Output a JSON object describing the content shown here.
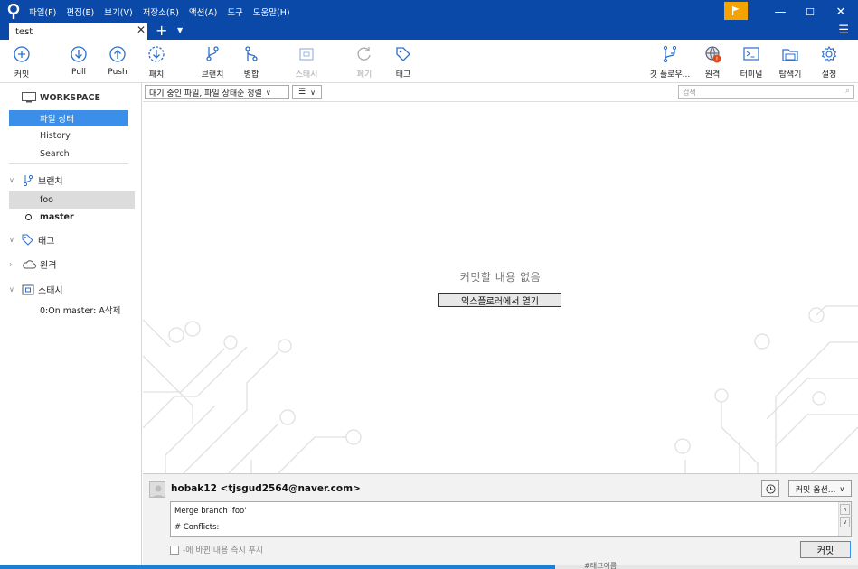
{
  "menubar": {
    "items": [
      "파일(F)",
      "편집(E)",
      "보기(V)",
      "저장소(R)",
      "액션(A)",
      "도구",
      "도움말(H)"
    ]
  },
  "window_controls": {
    "minimize": "—",
    "maximize": "☐",
    "close": "✕"
  },
  "tabs": {
    "active": "test",
    "close_glyph": "✕",
    "add_glyph": "+",
    "dropdown_glyph": "▼",
    "menu_glyph": "☰"
  },
  "toolbar": {
    "commit": "커밋",
    "pull": "Pull",
    "push": "Push",
    "fetch": "패치",
    "branch": "브랜치",
    "merge": "병합",
    "stash": "스태시",
    "discard": "폐기",
    "tag": "태그",
    "gitflow": "깃 플로우...",
    "remote": "원격",
    "terminal": "터미널",
    "explorer": "탐색기",
    "settings": "설정",
    "remote_badge": "!"
  },
  "sidebar": {
    "workspace_title": "WORKSPACE",
    "workspace_items": [
      "파일 상태",
      "History",
      "Search"
    ],
    "active_workspace_index": 0,
    "branches_title": "브랜치",
    "branches": [
      "foo",
      "master"
    ],
    "current_branch": "master",
    "tags_title": "태그",
    "remotes_title": "원격",
    "stashes_title": "스태시",
    "stashes": [
      "0:On master: A삭제"
    ]
  },
  "filterbar": {
    "filter_dropdown": "대기 중인 파일, 파일 상태순 정렬",
    "view_dropdown": "☰",
    "search_placeholder": "검색"
  },
  "main": {
    "empty_message": "커밋할 내용 없음",
    "open_in_explorer": "익스플로러에서 열기"
  },
  "commit": {
    "author": "hobak12 <tjsgud2564@naver.com>",
    "options": "커밋 옵션...",
    "message_line1": "Merge branch 'foo'",
    "message_line2": "# Conflicts:",
    "push_immediately": "-에 바뀐 내용 즉시 푸시",
    "commit_button": "커밋"
  },
  "background_peek": "#태그이름",
  "colors": {
    "titlebar": "#0a49a7",
    "accent": "#3b8fe8",
    "flag": "#f4a300",
    "badge": "#e04a1a"
  }
}
